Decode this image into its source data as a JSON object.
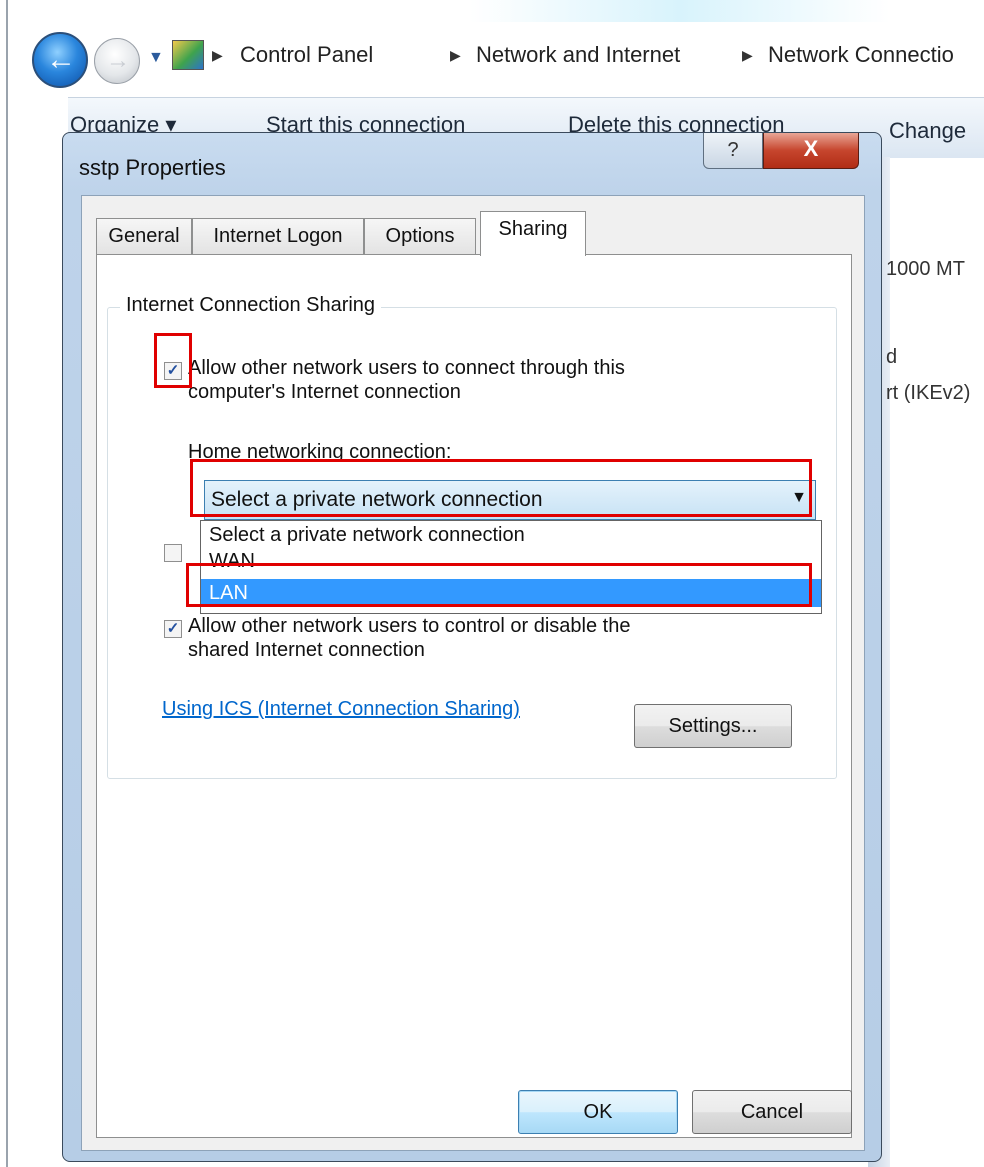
{
  "explorer": {
    "breadcrumb": [
      "Control Panel",
      "Network and Internet",
      "Network Connectio"
    ],
    "toolbar": {
      "organize": "Organize ▾",
      "start_connection": "Start this connection",
      "delete_connection": "Delete this connection",
      "change": "Change"
    },
    "background_text": [
      "1000 MT",
      "d",
      "rt (IKEv2)"
    ]
  },
  "dialog": {
    "title": "sstp Properties",
    "help_label": "?",
    "close_label": "X",
    "tabs": [
      "General",
      "Internet Logon",
      "Options",
      "Sharing"
    ],
    "active_tab": "Sharing",
    "group_label": "Internet Connection Sharing",
    "allow_connect": {
      "checked": true,
      "line1": "Allow other network users to connect through this",
      "line2": "computer's Internet connection"
    },
    "home_label": "Home networking connection:",
    "combo_value": "Select a private network connection",
    "dropdown_options": [
      "Select a private network connection",
      "WAN",
      "LAN"
    ],
    "selected_option": "LAN",
    "establish_dialup": {
      "checked": false
    },
    "allow_control": {
      "checked": true,
      "line1": "Allow other network users to control or disable the",
      "line2": "shared Internet connection"
    },
    "ics_link": "Using ICS (Internet Connection Sharing)",
    "settings_button": "Settings...",
    "ok_button": "OK",
    "cancel_button": "Cancel"
  },
  "colors": {
    "highlight_box": "#e00000",
    "selection": "#3399ff",
    "link": "#0066cc"
  }
}
